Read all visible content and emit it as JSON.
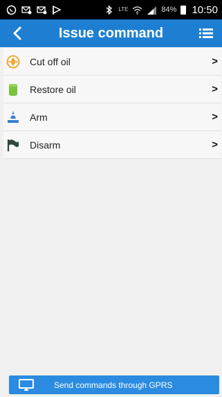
{
  "status_bar": {
    "icons_left": [
      "whatsapp-icon",
      "mail-icon",
      "mail-icon",
      "flag-icon"
    ],
    "icons_right": [
      "bluetooth-icon",
      "lte-icon",
      "wifi-icon",
      "signal-icon"
    ],
    "network": "LTE",
    "battery_percent": "84%",
    "time": "10:50"
  },
  "app_bar": {
    "title": "Issue command",
    "color": "#1e7fd2"
  },
  "commands": [
    {
      "label": "Cut off oil",
      "icon": "oil-cut-icon",
      "arrow": ">"
    },
    {
      "label": "Restore oil",
      "icon": "oil-restore-icon",
      "arrow": ">"
    },
    {
      "label": "Arm",
      "icon": "arm-icon",
      "arrow": ">"
    },
    {
      "label": "Disarm",
      "icon": "disarm-flag-icon",
      "arrow": ">"
    }
  ],
  "footer": {
    "button_label": "Send commands through GPRS",
    "button_icon": "monitor-icon",
    "color": "#2a8be0"
  }
}
